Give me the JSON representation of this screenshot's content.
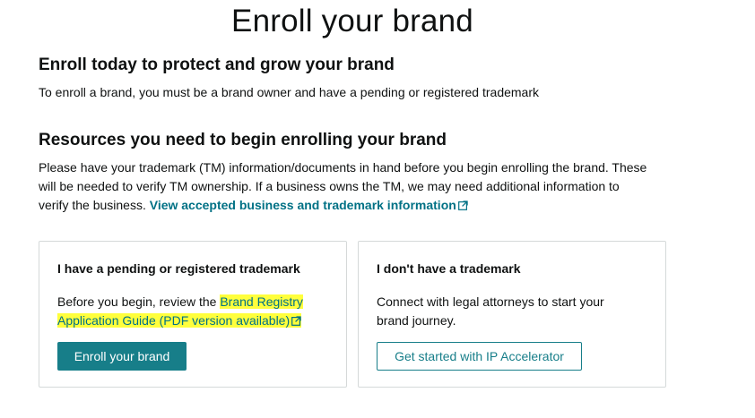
{
  "page": {
    "title": "Enroll your brand"
  },
  "enroll_section": {
    "heading": "Enroll today to protect and grow your brand",
    "text": "To enroll a brand, you must be a brand owner and have a pending or registered trademark"
  },
  "resources_section": {
    "heading": "Resources you need to begin enrolling your brand",
    "line1": "Please have your trademark (TM) information/documents in hand before you begin enrolling the brand. These",
    "line2": "will be needed to verify TM ownership. If a business owns the TM, we may need additional information to",
    "line3_prefix": "verify the business. ",
    "link_text": "View accepted business and trademark information"
  },
  "card_pending": {
    "title": "I have a pending or registered trademark",
    "body_prefix": "Before you begin, review the ",
    "link_line1": "Brand Registry",
    "link_line2": "Application Guide (PDF version available)",
    "button_label": "Enroll your brand"
  },
  "card_none": {
    "title": "I don't have a trademark",
    "body_line1": "Connect with legal attorneys to start your",
    "body_line2": "brand journey.",
    "button_label": "Get started with IP Accelerator"
  },
  "colors": {
    "accent": "#177e89",
    "link": "#007185",
    "highlight": "#ffff3c",
    "border": "#d5d9d9"
  },
  "icons": {
    "external": "external-link-icon"
  }
}
